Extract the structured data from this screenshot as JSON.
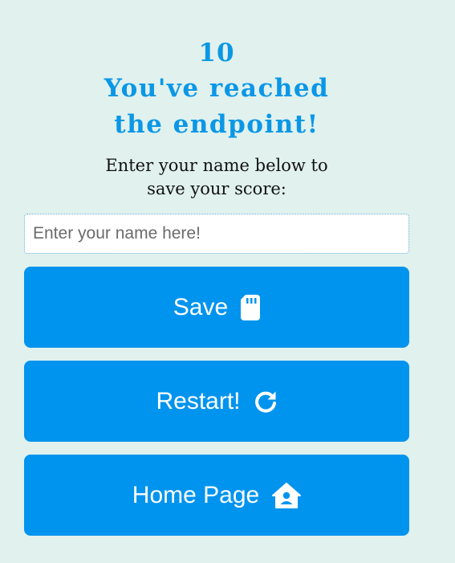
{
  "result": {
    "score": "10",
    "title_line1": "You've reached",
    "title_line2": "the endpoint!",
    "prompt_line1": "Enter your name below to",
    "prompt_line2": "save your score:"
  },
  "name_input": {
    "value": "",
    "placeholder": "Enter your name here!"
  },
  "buttons": {
    "save_label": "Save",
    "save_icon": "sd-card-icon",
    "restart_label": "Restart!",
    "restart_icon": "redo-icon",
    "home_label": "Home Page",
    "home_icon": "home-user-icon"
  },
  "colors": {
    "background": "#e0f1ee",
    "accent": "#0b97e6",
    "button": "#0194ee",
    "button_text": "#ffffff"
  }
}
